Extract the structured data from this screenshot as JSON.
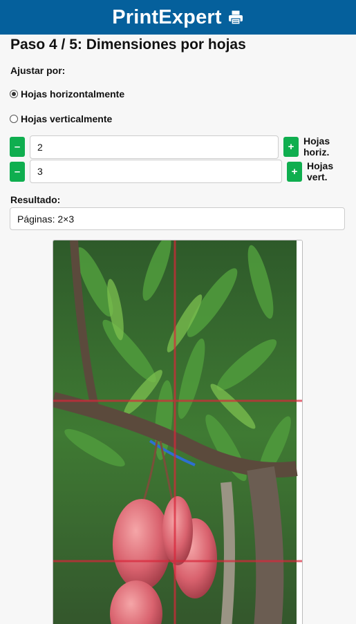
{
  "header": {
    "title": "PrintExpert",
    "icon": "printer-icon"
  },
  "step_title": "Paso 4 / 5: Dimensiones por hojas",
  "fit": {
    "label": "Ajustar por:",
    "options": [
      {
        "label": "Hojas horizontalmente",
        "selected": true
      },
      {
        "label": "Hojas verticalmente",
        "selected": false
      }
    ]
  },
  "horizontal": {
    "minus": "–",
    "value": "2",
    "plus": "+",
    "label_line1": "Hojas",
    "label_line2": "horiz."
  },
  "vertical": {
    "minus": "–",
    "value": "3",
    "plus": "+",
    "label_line1": "Hojas",
    "label_line2": "vert."
  },
  "result": {
    "label": "Resultado:",
    "value": "Páginas: 2×3"
  },
  "preview": {
    "grid_columns": 2,
    "grid_rows": 3,
    "grid_color": "#d9263a",
    "accent": "#0fae4f",
    "brand": "#05609c"
  }
}
